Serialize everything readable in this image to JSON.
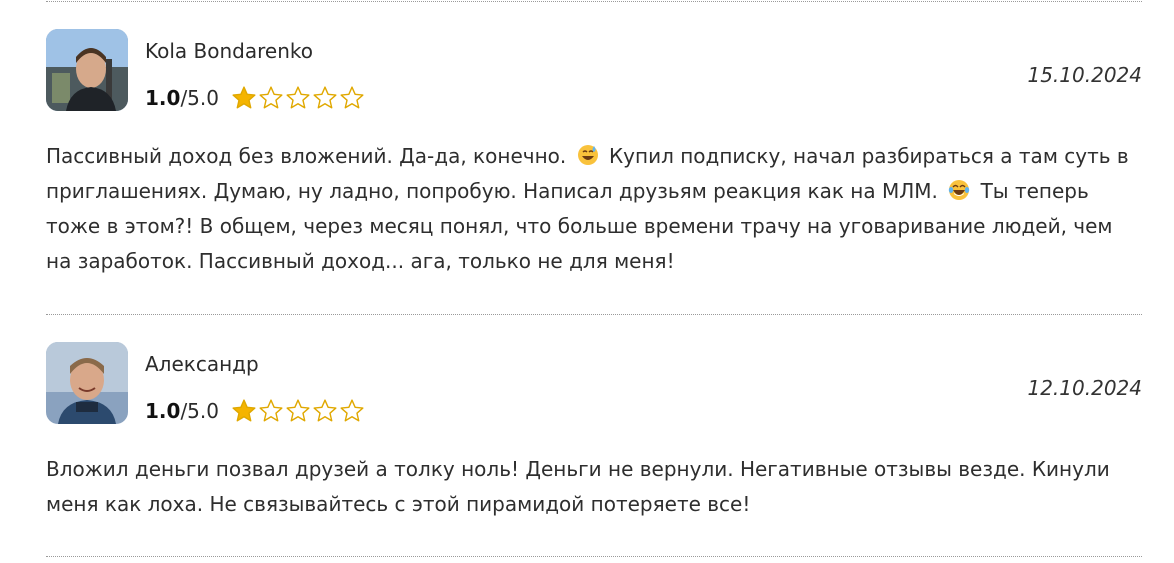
{
  "reviews": [
    {
      "author": "Kola Bondarenko",
      "score": "1.0",
      "max_score": "/5.0",
      "rating_value": 1.0,
      "rating_max": 5,
      "date": "15.10.2024",
      "text_parts": [
        "Пассивный доход без вложений. Да-да, конечно.",
        "Купил подписку, начал разбираться а там суть в приглашениях. Думаю, ну ладно, попробую. Написал друзьям реакция как на МЛМ.",
        "Ты теперь тоже в этом?! В общем, через месяц понял, что больше времени трачу на уговаривание людей, чем на заработок. Пассивный доход... ага, только не для меня!"
      ],
      "emojis": [
        "sweat-smile-emoji",
        "tears-of-joy-emoji"
      ]
    },
    {
      "author": "Александр",
      "score": "1.0",
      "max_score": "/5.0",
      "rating_value": 1.0,
      "rating_max": 5,
      "date": "12.10.2024",
      "text": "Вложил деньги позвал друзей а толку ноль! Деньги не вернули. Негативные отзывы везде. Кинули меня как лоха. Не связывайтесь с этой пирамидой потеряете все!"
    }
  ],
  "colors": {
    "star_fill": "#f5b400",
    "star_outline": "#e0a800",
    "divider": "#9a9a9a"
  }
}
